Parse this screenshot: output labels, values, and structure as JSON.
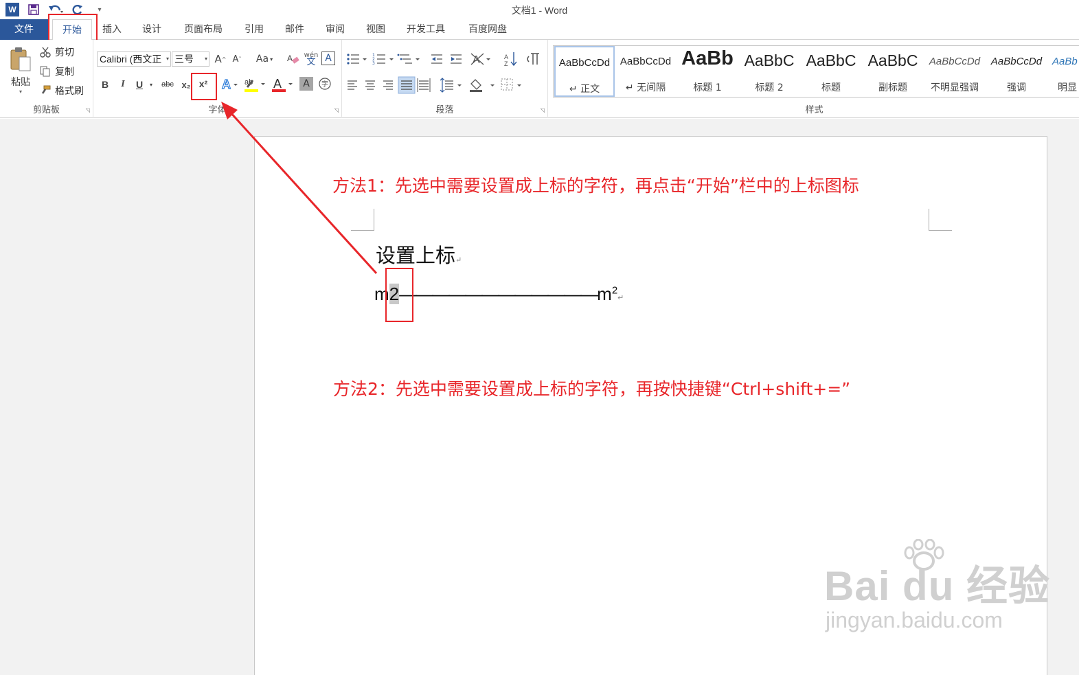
{
  "window": {
    "title": "文档1 - Word"
  },
  "quick_access": {
    "icons": [
      "word-logo",
      "save-icon",
      "undo-icon",
      "redo-icon",
      "customize-icon"
    ]
  },
  "tabs": [
    {
      "label": "文件"
    },
    {
      "label": "开始"
    },
    {
      "label": "插入"
    },
    {
      "label": "设计"
    },
    {
      "label": "页面布局"
    },
    {
      "label": "引用"
    },
    {
      "label": "邮件"
    },
    {
      "label": "审阅"
    },
    {
      "label": "视图"
    },
    {
      "label": "开发工具"
    },
    {
      "label": "百度网盘"
    }
  ],
  "clipboard": {
    "group_label": "剪贴板",
    "paste": "粘贴",
    "cut": "剪切",
    "copy": "复制",
    "format_painter": "格式刷"
  },
  "font": {
    "group_label": "字体",
    "font_name": "Calibri (西文正",
    "font_size": "三号",
    "grow": "A",
    "shrink": "A",
    "change_case": "Aa",
    "bold": "B",
    "italic": "I",
    "underline": "U",
    "strikethrough": "abc",
    "subscript": "x₂",
    "superscript": "x²"
  },
  "paragraph": {
    "group_label": "段落"
  },
  "styles": {
    "group_label": "样式",
    "items": [
      {
        "sample": "AaBbCcDd",
        "name": "↵ 正文"
      },
      {
        "sample": "AaBbCcDd",
        "name": "↵ 无间隔"
      },
      {
        "sample": "AaBb",
        "name": "标题 1"
      },
      {
        "sample": "AaBbC",
        "name": "标题 2"
      },
      {
        "sample": "AaBbC",
        "name": "标题"
      },
      {
        "sample": "AaBbC",
        "name": "副标题"
      },
      {
        "sample": "AaBbCcDd",
        "name": "不明显强调"
      },
      {
        "sample": "AaBbCcDd",
        "name": "强调"
      },
      {
        "sample": "AaBb",
        "name": "明显"
      }
    ]
  },
  "document": {
    "annotation_1": "方法1：先选中需要设置成上标的字符，再点击“开始”栏中的上标图标",
    "heading": "设置上标",
    "para_mark": "↵",
    "line_start": "m",
    "selected_char": "2",
    "dashes": "————————————",
    "line_end": "m",
    "superscript_char": "2",
    "annotation_2": "方法2：先选中需要设置成上标的字符，再按快捷键“Ctrl+shift+=”"
  },
  "watermark": {
    "brand": "Bai du 经验",
    "url": "jingyan.baidu.com"
  },
  "colors": {
    "accent": "#2b579a",
    "annotation_red": "#e8262a",
    "selection_gray": "#c8c8c8"
  }
}
